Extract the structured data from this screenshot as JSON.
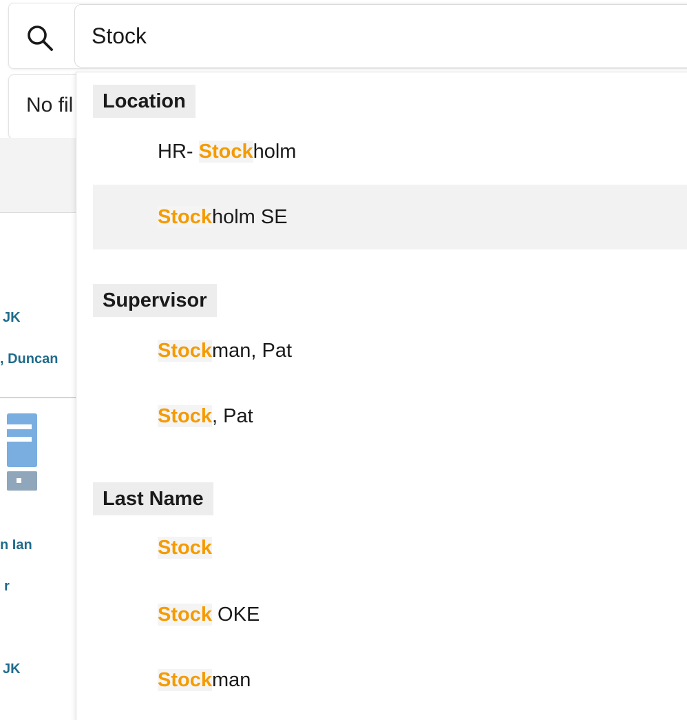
{
  "search": {
    "value": "Stock",
    "match": "Stock"
  },
  "background": {
    "filter_text": "No fil",
    "links": [
      "JK",
      ", Duncan",
      "n Ian",
      "r",
      "JK"
    ]
  },
  "groups": [
    {
      "label": "Location",
      "items": [
        {
          "prefix": "HR- ",
          "match": "Stock",
          "suffix": "holm",
          "highlighted": false
        },
        {
          "prefix": "",
          "match": "Stock",
          "suffix": "holm SE",
          "highlighted": true
        }
      ]
    },
    {
      "label": "Supervisor",
      "items": [
        {
          "prefix": "",
          "match": "Stock",
          "suffix": "man, Pat",
          "highlighted": false
        },
        {
          "prefix": "",
          "match": "Stock",
          "suffix": ", Pat",
          "highlighted": false
        }
      ]
    },
    {
      "label": "Last Name",
      "items": [
        {
          "prefix": "",
          "match": "Stock",
          "suffix": "",
          "highlighted": false
        },
        {
          "prefix": "",
          "match": "Stock",
          "suffix": " OKE",
          "highlighted": false
        },
        {
          "prefix": "",
          "match": "Stock",
          "suffix": "man",
          "highlighted": false
        }
      ]
    }
  ],
  "colors": {
    "match": "#f59b00",
    "link": "#1f6b8c",
    "highlight_row": "#f2f2f2",
    "header_bg": "#ededed"
  },
  "icons": {
    "search": "search-icon",
    "server": "server-icon"
  }
}
